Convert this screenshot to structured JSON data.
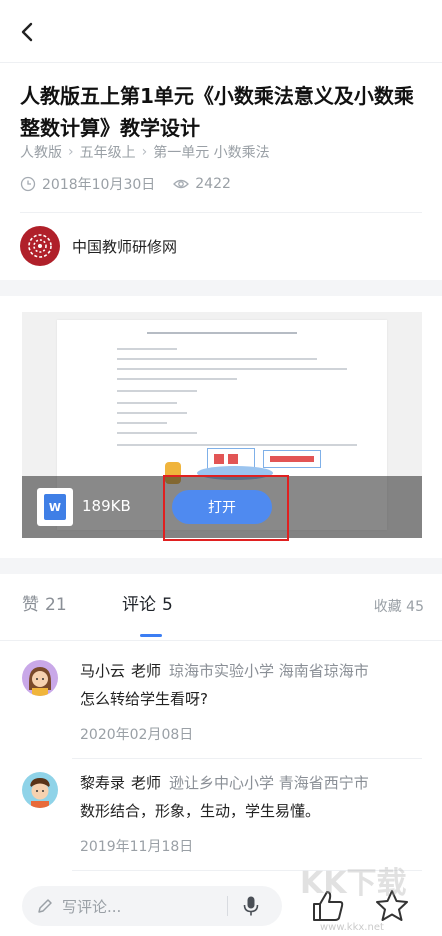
{
  "header": {
    "back_icon": "chevron-left-icon"
  },
  "article": {
    "title": "人教版五上第1单元《小数乘法意义及小数乘整数计算》教学设计",
    "breadcrumbs": [
      "人教版",
      "五年级上",
      "第一单元 小数乘法"
    ],
    "date": "2018年10月30日",
    "views": "2422"
  },
  "publisher": {
    "name": "中国教师研修网"
  },
  "attachment": {
    "file_type_icon": "word-file-icon",
    "file_type_letter": "W",
    "size": "189KB",
    "open_label": "打开"
  },
  "tabs": {
    "like_label": "赞",
    "like_count": "21",
    "comment_label": "评论",
    "comment_count": "5",
    "favorite": "收藏 45"
  },
  "comments": [
    {
      "user": "马小云",
      "role": "老师",
      "school": "琼海市实验小学 海南省琼海市",
      "text": "怎么转给学生看呀?",
      "date": "2020年02月08日"
    },
    {
      "user": "黎寿录",
      "role": "老师",
      "school": "逊让乡中心小学 青海省西宁市",
      "text": "数形结合，形象，生动，学生易懂。",
      "date": "2019年11月18日"
    }
  ],
  "composer": {
    "placeholder": "写评论..."
  },
  "watermark": {
    "text": "KK下载",
    "url": "www.kkx.net"
  },
  "colors": {
    "accent": "#3c7ef3",
    "open_button": "#4f8af0",
    "highlight": "#e02020",
    "logo": "#b0202a"
  }
}
